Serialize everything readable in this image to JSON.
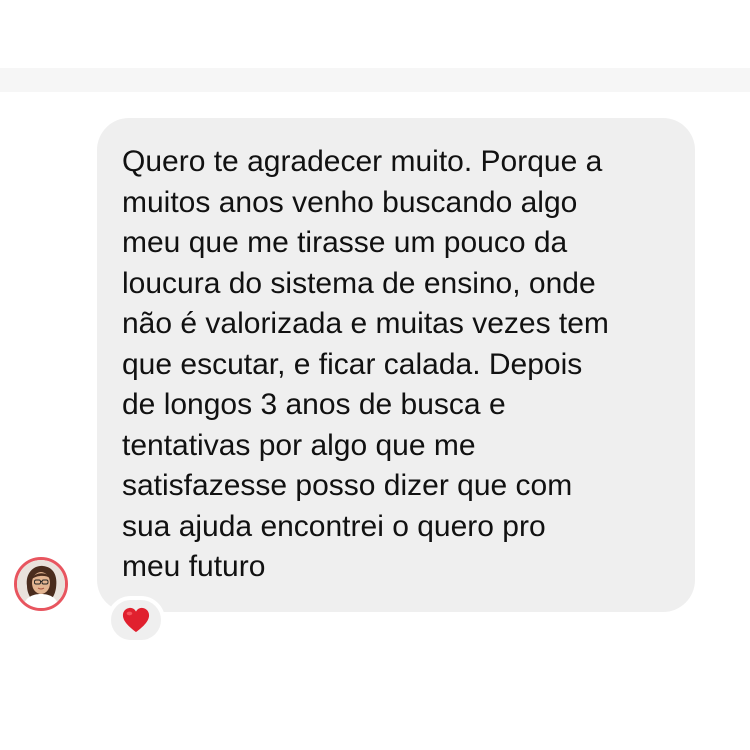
{
  "thread": {
    "message": {
      "lines": [
        "Quero te agradecer muito. Porque a",
        "muitos anos venho buscando algo",
        "meu que me tirasse um pouco da",
        "loucura do sistema de ensino, onde",
        "não é valorizada e muitas vezes tem",
        "que escutar, e ficar calada. Depois",
        "de longos 3 anos de busca e",
        "tentativas por algo que me",
        "satisfazesse posso dizer que com",
        "sua ajuda encontrei o quero pro",
        "meu futuro"
      ],
      "reaction": {
        "icon": "red-heart-icon",
        "color": "#e0202e"
      }
    },
    "sender": {
      "avatar_icon": "profile-photo-avatar",
      "ring_color": "#e8555f"
    }
  }
}
